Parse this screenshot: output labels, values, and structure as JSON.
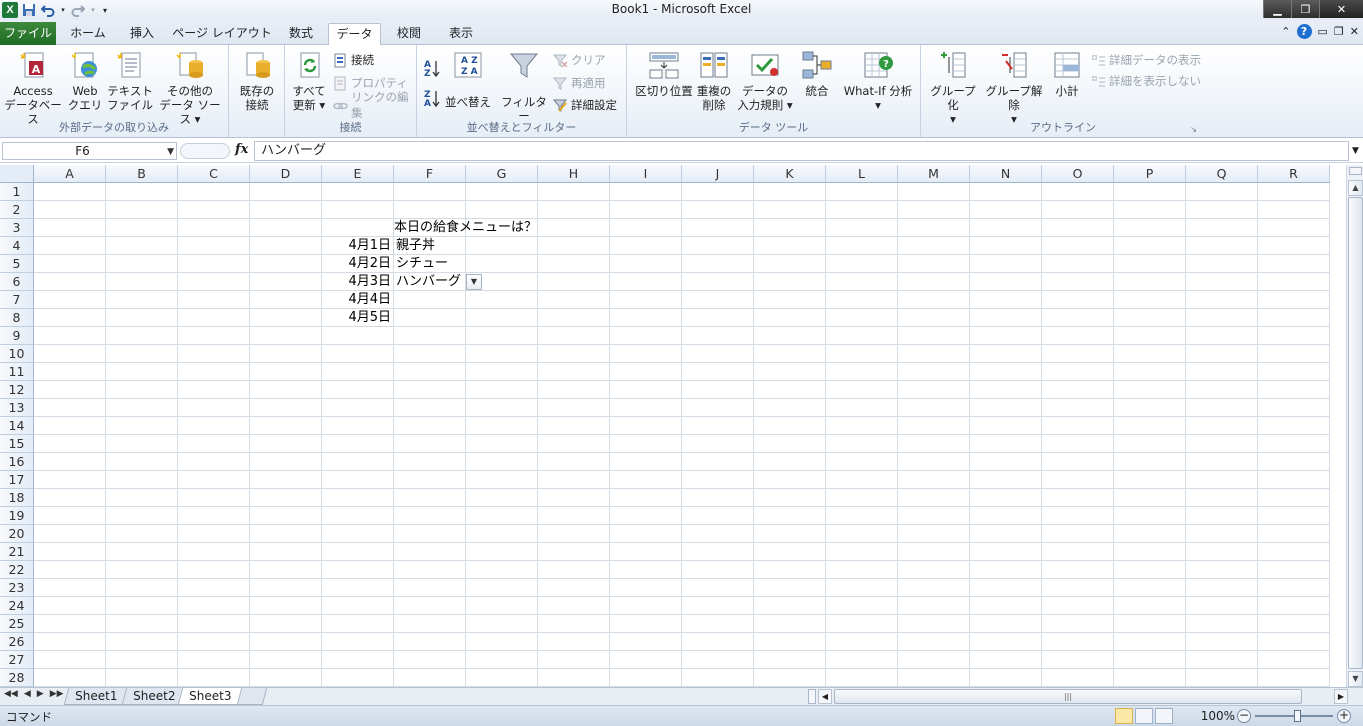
{
  "window": {
    "title": "Book1 - Microsoft Excel",
    "app_icon": "X"
  },
  "ribbon_tabs": [
    {
      "label": "ファイル",
      "active": false
    },
    {
      "label": "ホーム",
      "active": false
    },
    {
      "label": "挿入",
      "active": false
    },
    {
      "label": "ページ レイアウト",
      "active": false
    },
    {
      "label": "数式",
      "active": false
    },
    {
      "label": "データ",
      "active": true
    },
    {
      "label": "校閲",
      "active": false
    },
    {
      "label": "表示",
      "active": false
    }
  ],
  "ribbon": {
    "external_data": {
      "group_label": "外部データの取り込み",
      "access_l1": "Access",
      "access_l2": "データベース",
      "web_l1": "Web",
      "web_l2": "クエリ",
      "text_l1": "テキスト",
      "text_l2": "ファイル",
      "other_l1": "その他の",
      "other_l2": "データ ソース ▾",
      "existing_l1": "既存の",
      "existing_l2": "接続"
    },
    "connections": {
      "group_label": "接続",
      "refresh_l1": "すべて",
      "refresh_l2": "更新 ▾",
      "connections": "接続",
      "properties": "プロパティ",
      "edit_links": "リンクの編集"
    },
    "sort_filter": {
      "group_label": "並べ替えとフィルター",
      "sort": "並べ替え",
      "filter": "フィルター",
      "clear": "クリア",
      "reapply": "再適用",
      "advanced": "詳細設定"
    },
    "data_tools": {
      "group_label": "データ ツール",
      "text_to_columns": "区切り位置",
      "remove_dup_l1": "重複の",
      "remove_dup_l2": "削除",
      "validation_l1": "データの",
      "validation_l2": "入力規則 ▾",
      "consolidate": "統合",
      "whatif_l1": "What-If 分析",
      "whatif_l2": "▾"
    },
    "outline": {
      "group_label": "アウトライン",
      "group_l1": "グループ化",
      "group_l2": "▾",
      "ungroup_l1": "グループ解除",
      "ungroup_l2": "▾",
      "subtotal": "小計",
      "show_detail": "詳細データの表示",
      "hide_detail": "詳細を表示しない"
    }
  },
  "formula_bar": {
    "name_box": "F6",
    "fx": "fx",
    "value": "ハンバーグ"
  },
  "columns": [
    "A",
    "B",
    "C",
    "D",
    "E",
    "F",
    "G",
    "H",
    "I",
    "J",
    "K",
    "L",
    "M",
    "N",
    "O",
    "P",
    "Q",
    "R"
  ],
  "rows": [
    "1",
    "2",
    "3",
    "4",
    "5",
    "6",
    "7",
    "8",
    "9",
    "10",
    "11",
    "12",
    "13",
    "14",
    "15",
    "16",
    "17",
    "18",
    "19",
    "20",
    "21",
    "22",
    "23",
    "24",
    "25",
    "26",
    "27",
    "28"
  ],
  "cells": {
    "F3": "本日の給食メニューは？",
    "E4": "4月1日",
    "F4": "親子丼",
    "E5": "4月2日",
    "F5": "シチュー",
    "E6": "4月3日",
    "F6": "ハンバーグ",
    "E7": "4月4日",
    "E8": "4月5日"
  },
  "sheet_tabs": [
    {
      "label": "Sheet1",
      "active": false
    },
    {
      "label": "Sheet2",
      "active": false
    },
    {
      "label": "Sheet3",
      "active": true
    }
  ],
  "status": {
    "mode": "コマンド",
    "zoom": "100%"
  }
}
